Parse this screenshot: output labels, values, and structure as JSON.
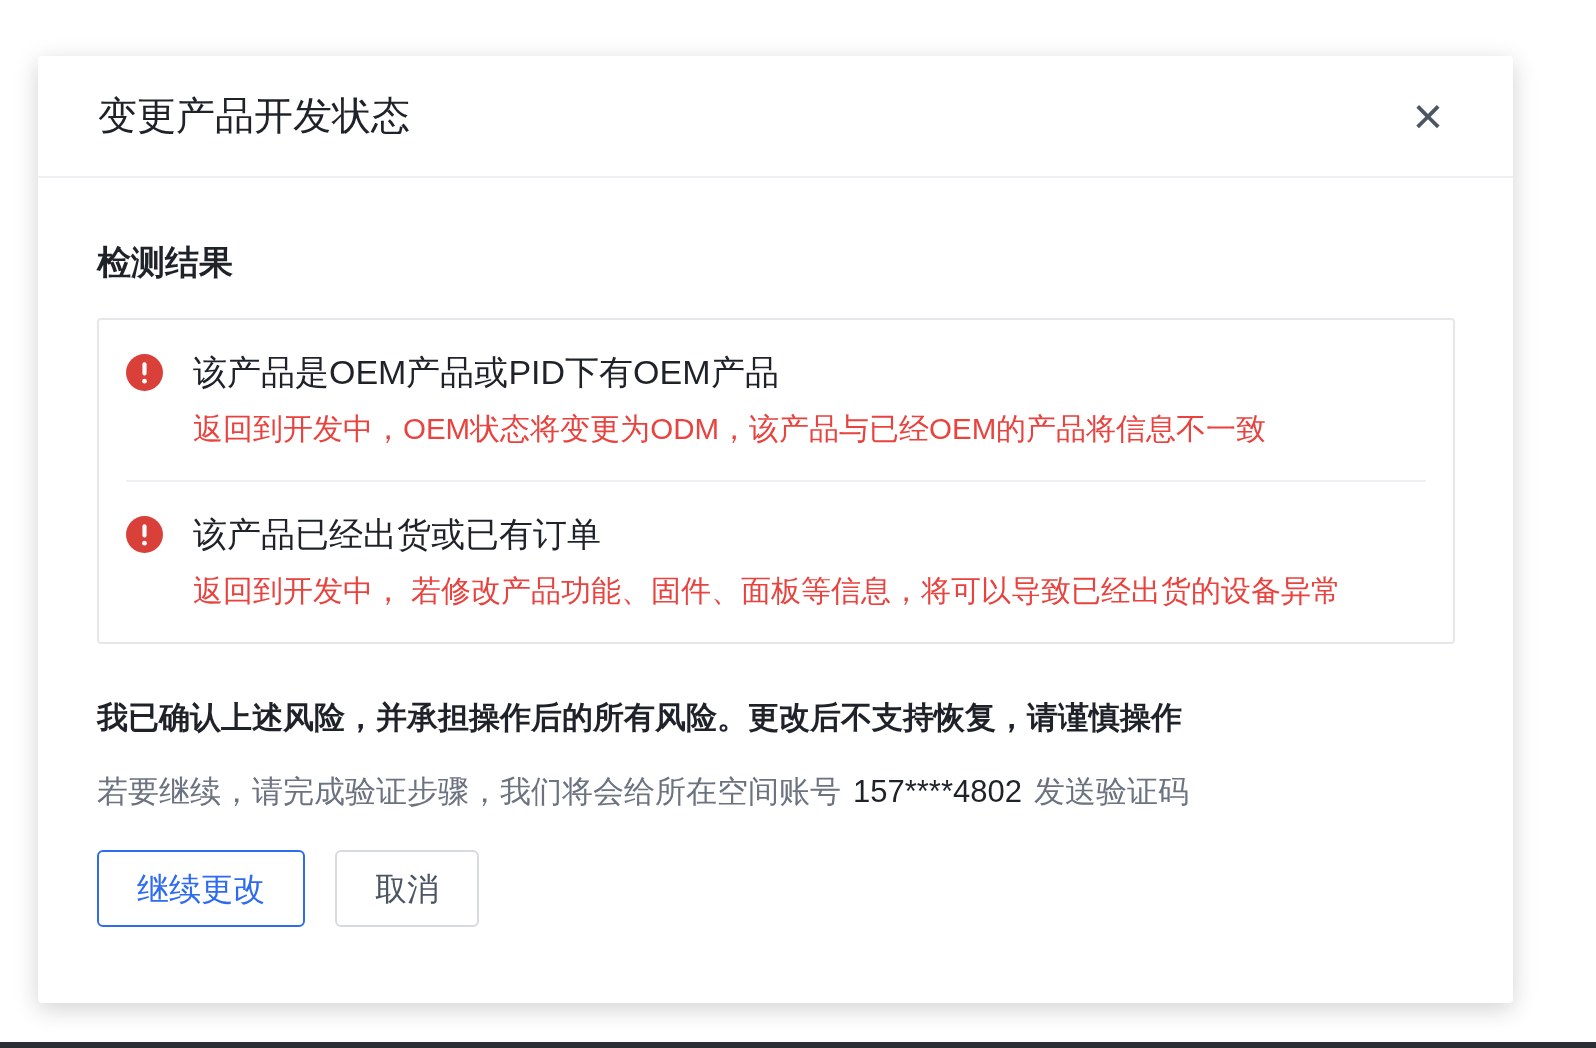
{
  "dialog": {
    "title": "变更产品开发状态",
    "close": "×"
  },
  "section_title": "检测结果",
  "results": [
    {
      "title": "该产品是OEM产品或PID下有OEM产品",
      "detail": "返回到开发中，OEM状态将变更为ODM，该产品与已经OEM的产品将信息不一致"
    },
    {
      "title": "该产品已经出货或已有订单",
      "detail": "返回到开发中， 若修改产品功能、固件、面板等信息，将可以导致已经出货的设备异常"
    }
  ],
  "confirmation": "我已确认上述风险，并承担操作后的所有风险。更改后不支持恢复，请谨慎操作",
  "verification": {
    "before": "若要继续，请完成验证步骤，我们将会给所在空间账号",
    "account": "157****4802",
    "after": "发送验证码"
  },
  "buttons": [
    {
      "label": "继续更改",
      "kind": "primary"
    },
    {
      "label": "取消",
      "kind": "default"
    }
  ]
}
